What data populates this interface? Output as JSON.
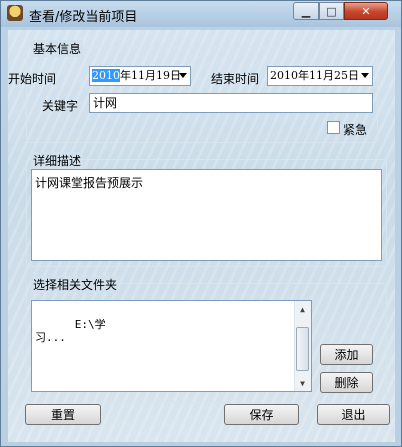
{
  "window": {
    "title": "查看/修改当前项目"
  },
  "basic_info": {
    "group_label": "基本信息",
    "start_label": "开始时间",
    "start_date_selected": "2010",
    "start_date_rest": "年11月19日",
    "end_label": "结束时间",
    "end_date": "2010年11月25日",
    "keyword_label": "关键字",
    "keyword_value": "计网",
    "urgent_label": "紧急"
  },
  "detail": {
    "group_label": "详细描述",
    "text": "计网课堂报告预展示"
  },
  "folders": {
    "group_label": "选择相关文件夹",
    "text": "E:\\学\n习...",
    "add_label": "添加",
    "delete_label": "删除"
  },
  "footer": {
    "reset_label": "重置",
    "save_label": "保存",
    "exit_label": "退出"
  },
  "icons": {
    "minimize": "▁",
    "maximize": "□",
    "close": "✕",
    "scroll_up": "▲",
    "scroll_down": "▼"
  }
}
